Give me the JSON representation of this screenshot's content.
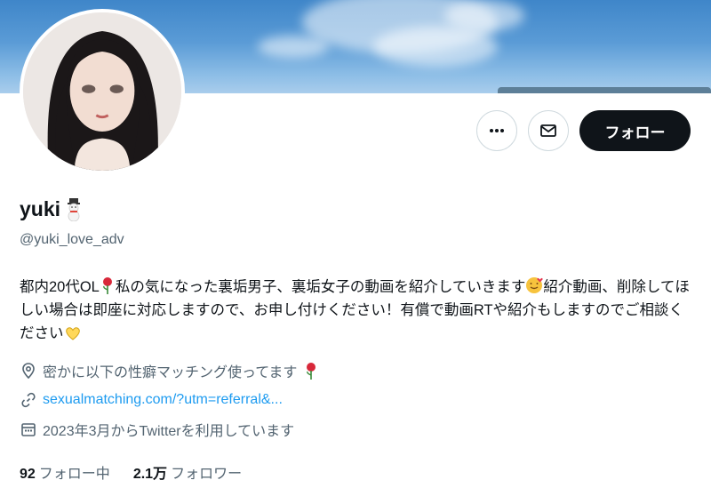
{
  "header": {
    "more_icon": "more-horizontal-icon",
    "message_icon": "envelope-icon",
    "follow_label": "フォロー"
  },
  "profile": {
    "name": "yuki",
    "name_emoji": "snowman-emoji",
    "handle": "@yuki_love_adv",
    "bio": {
      "part1": "都内20代OL",
      "part2": "私の気になった裏垢男子、裏垢女子の動画を紹介していきます",
      "part3": "紹介動画、削除してほしい場合は即座に対応しますので、お申し付けください！有償で動画RTや紹介もしますのでご相談ください"
    },
    "location": "密かに以下の性癖マッチング使ってます",
    "website": "sexualmatching.com/?utm=referral&...",
    "joined": "2023年3月からTwitterを利用しています"
  },
  "stats": {
    "following_count": "92",
    "following_label": "フォロー中",
    "followers_count": "2.1万",
    "followers_label": "フォロワー"
  },
  "colors": {
    "accent_link": "#1d9bf0",
    "text_primary": "#0f1419",
    "text_secondary": "#536471",
    "follow_button_bg": "#0f1419"
  }
}
